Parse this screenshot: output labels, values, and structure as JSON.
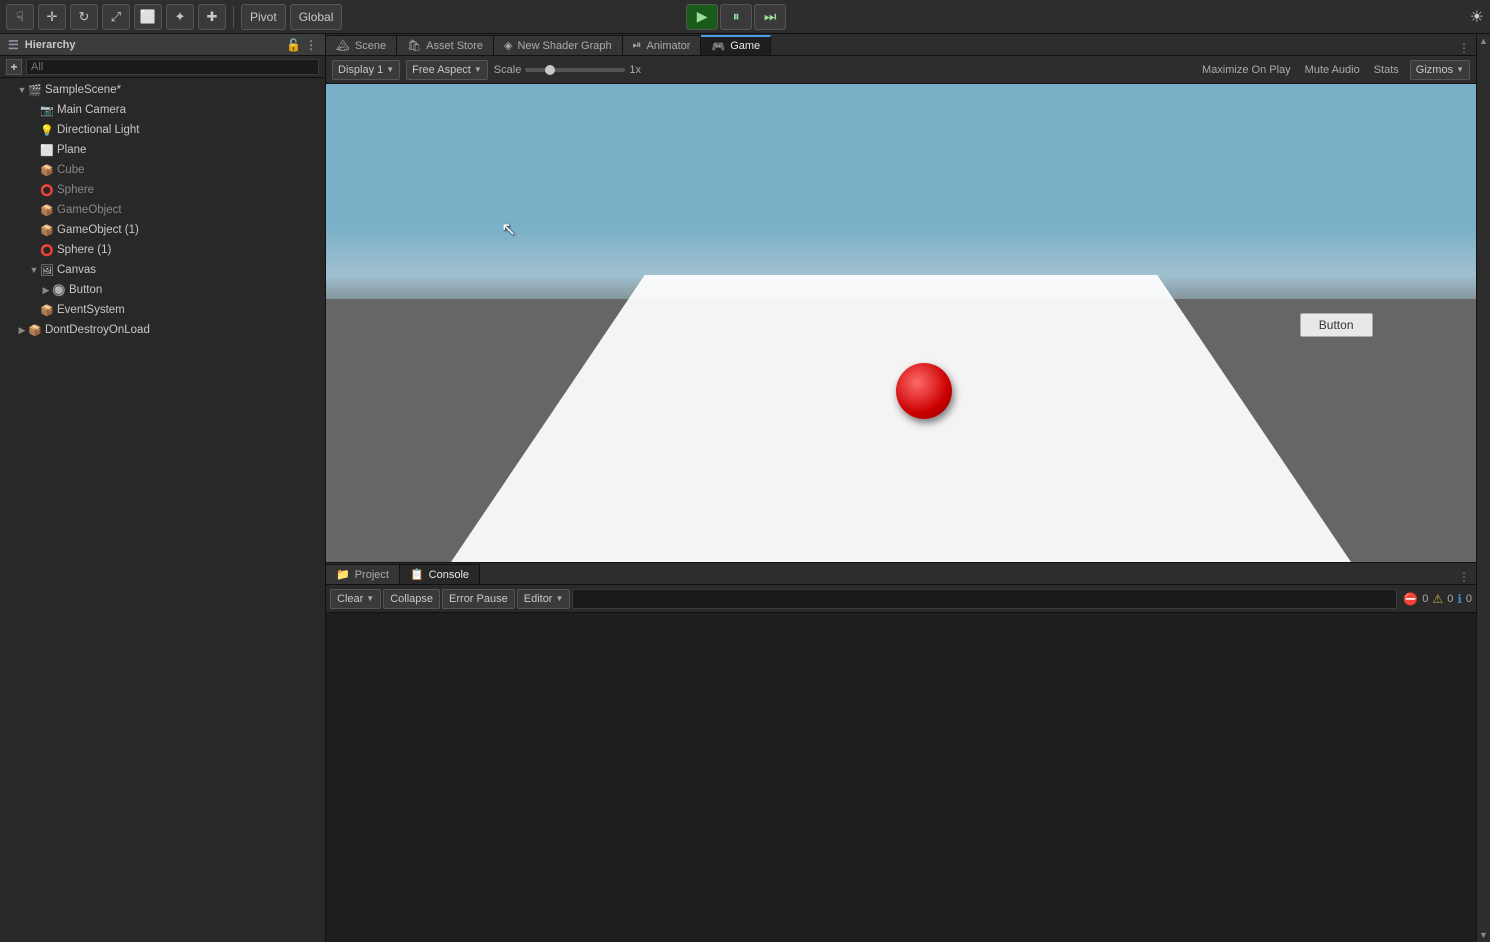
{
  "toolbar": {
    "pivot_label": "Pivot",
    "global_label": "Global",
    "play_btn": "▶",
    "pause_btn": "⏸",
    "step_btn": "⏭",
    "sun_icon": "☀"
  },
  "hierarchy": {
    "panel_title": "Hierarchy",
    "search_placeholder": "All",
    "scene_name": "SampleScene*",
    "items": [
      {
        "label": "Main Camera",
        "indent": 2,
        "toggle": false,
        "icon": "📷",
        "greyed": false
      },
      {
        "label": "Directional Light",
        "indent": 2,
        "toggle": false,
        "icon": "💡",
        "greyed": false
      },
      {
        "label": "Plane",
        "indent": 2,
        "toggle": false,
        "icon": "🔲",
        "greyed": false
      },
      {
        "label": "Cube",
        "indent": 2,
        "toggle": false,
        "icon": "📦",
        "greyed": true
      },
      {
        "label": "Sphere",
        "indent": 2,
        "toggle": false,
        "icon": "⚪",
        "greyed": true
      },
      {
        "label": "GameObject",
        "indent": 2,
        "toggle": false,
        "icon": "📦",
        "greyed": true
      },
      {
        "label": "GameObject (1)",
        "indent": 2,
        "toggle": false,
        "icon": "📦",
        "greyed": false
      },
      {
        "label": "Sphere (1)",
        "indent": 2,
        "toggle": false,
        "icon": "⚪",
        "greyed": false
      },
      {
        "label": "Canvas",
        "indent": 2,
        "toggle": true,
        "expanded": true,
        "icon": "🖼",
        "greyed": false
      },
      {
        "label": "Button",
        "indent": 4,
        "toggle": true,
        "expanded": false,
        "icon": "🔘",
        "greyed": false
      },
      {
        "label": "EventSystem",
        "indent": 2,
        "toggle": false,
        "icon": "📦",
        "greyed": false
      },
      {
        "label": "DontDestroyOnLoad",
        "indent": 1,
        "toggle": true,
        "expanded": false,
        "icon": "📦",
        "greyed": false
      }
    ]
  },
  "tabs": {
    "scene": "Scene",
    "asset_store": "Asset Store",
    "new_shader_graph": "New Shader Graph",
    "animator": "Animator",
    "game": "Game"
  },
  "game_toolbar": {
    "display_label": "Display 1",
    "aspect_label": "Free Aspect",
    "scale_label": "Scale",
    "scale_value": "1x",
    "maximize_on_play": "Maximize On Play",
    "mute_audio": "Mute Audio",
    "stats": "Stats",
    "gizmos": "Gizmos"
  },
  "game_scene": {
    "button_label": "Button",
    "cursor_symbol": "↖"
  },
  "bottom": {
    "project_tab": "Project",
    "console_tab": "Console",
    "clear_btn": "Clear",
    "collapse_btn": "Collapse",
    "error_pause_btn": "Error Pause",
    "editor_dropdown": "Editor",
    "search_placeholder": "",
    "error_count": "0",
    "warn_count": "0",
    "info_count": "0"
  }
}
